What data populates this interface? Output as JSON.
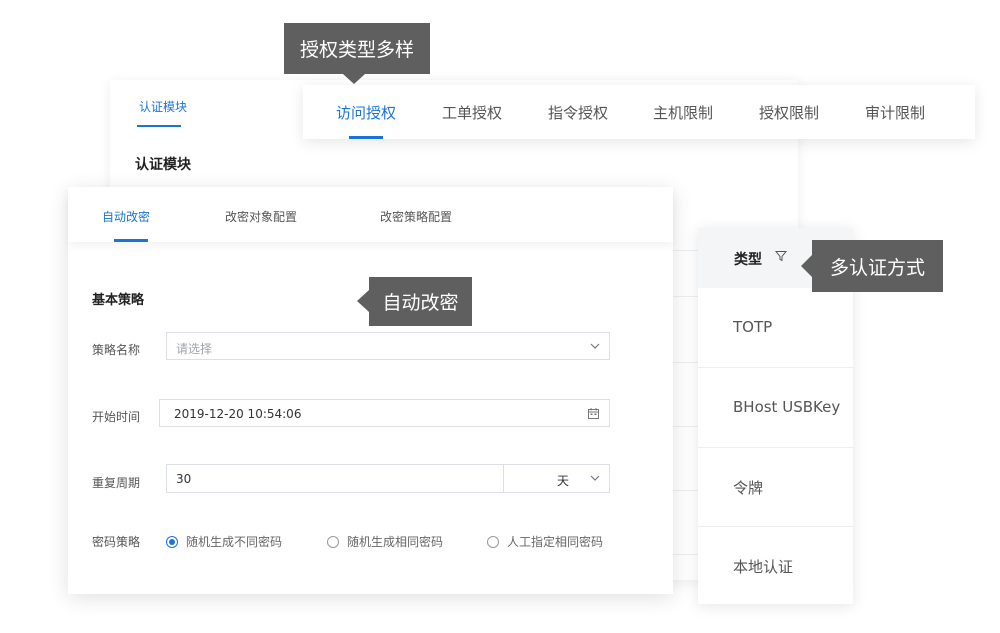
{
  "top_tooltip": "授权类型多样",
  "top_tabs": [
    {
      "label": "访问授权",
      "active": true
    },
    {
      "label": "工单授权",
      "active": false
    },
    {
      "label": "指令授权",
      "active": false
    },
    {
      "label": "主机限制",
      "active": false
    },
    {
      "label": "授权限制",
      "active": false
    },
    {
      "label": "审计限制",
      "active": false
    }
  ],
  "back_card": {
    "tab": "认证模块",
    "title": "认证模块"
  },
  "main_card": {
    "tabs": [
      {
        "label": "自动改密",
        "active": true
      },
      {
        "label": "改密对象配置",
        "active": false
      },
      {
        "label": "改密策略配置",
        "active": false
      }
    ],
    "tooltip": "自动改密",
    "section_title": "基本策略",
    "strategy_name": {
      "label": "策略名称",
      "placeholder": "请选择"
    },
    "start_time": {
      "label": "开始时间",
      "value": "2019-12-20   10:54:06"
    },
    "repeat_cycle": {
      "label": "重复周期",
      "value": "30",
      "unit": "天"
    },
    "password_policy": {
      "label": "密码策略",
      "options": [
        {
          "label": "随机生成不同密码",
          "selected": true
        },
        {
          "label": "随机生成相同密码",
          "selected": false
        },
        {
          "label": "人工指定相同密码",
          "selected": false
        }
      ]
    }
  },
  "auth_types": {
    "header": "类型",
    "tooltip": "多认证方式",
    "items": [
      "TOTP",
      "BHost USBKey",
      "令牌",
      "本地认证"
    ]
  },
  "colors": {
    "accent": "#1a73d9",
    "tooltip_bg": "#5f5f5f"
  }
}
